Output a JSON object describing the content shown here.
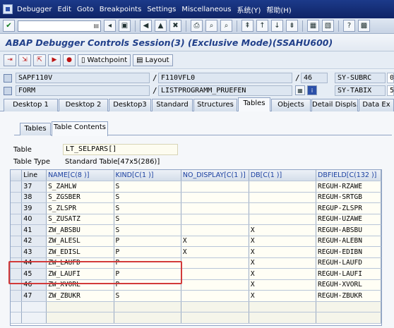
{
  "menu": [
    "Debugger",
    "Edit",
    "Goto",
    "Breakpoints",
    "Settings",
    "Miscellaneous",
    "系统(Y)",
    "帮助(H)"
  ],
  "title": "ABAP Debugger Controls Session(3)  (Exclusive Mode)(SSAHU600)",
  "toolbar": {
    "watchpoint": "Watchpoint",
    "layout": "Layout"
  },
  "info": {
    "program": "SAPF110V",
    "include": "F110VFL0",
    "line": "46",
    "subrc_label": "SY-SUBRC",
    "subrc_value": "0",
    "event_type": "FORM",
    "event_name": "LISTPROGRAMM_PRUEFEN",
    "tabix_label": "SY-TABIX",
    "tabix_value": "5"
  },
  "tabs": [
    "Desktop 1",
    "Desktop 2",
    "Desktop3",
    "Standard",
    "Structures",
    "Tables",
    "Objects",
    "Detail Displs.",
    "Data Ex"
  ],
  "subtabs": [
    "Tables",
    "Table Contents"
  ],
  "table": {
    "name_label": "Table",
    "name_value": "LT_SELPARS[]",
    "type_label": "Table Type",
    "type_value": "Standard Table[47x5(286)]"
  },
  "grid": {
    "headers": [
      "Line",
      "NAME[C(8 )]",
      "KIND[C(1 )]",
      "NO_DISPLAY[C(1 )]",
      "DB[C(1 )]",
      "DBFIELD[C(132 )]"
    ],
    "rows": [
      [
        "37",
        "S_ZAHLW",
        "S",
        "",
        "",
        "REGUH-RZAWE"
      ],
      [
        "38",
        "S_ZGSBER",
        "S",
        "",
        "",
        "REGUH-SRTGB"
      ],
      [
        "39",
        "S_ZLSPR",
        "S",
        "",
        "",
        "REGUP-ZLSPR"
      ],
      [
        "40",
        "S_ZUSATZ",
        "S",
        "",
        "",
        "REGUH-UZAWE"
      ],
      [
        "41",
        "ZW_ABSBU",
        "S",
        "",
        "X",
        "REGUH-ABSBU"
      ],
      [
        "42",
        "ZW_ALESL",
        "P",
        "X",
        "X",
        "REGUH-ALEBN"
      ],
      [
        "43",
        "ZW_EDISL",
        "P",
        "X",
        "X",
        "REGUH-EDIBN"
      ],
      [
        "44",
        "ZW_LAUFD",
        "P",
        "",
        "X",
        "REGUH-LAUFD"
      ],
      [
        "45",
        "ZW_LAUFI",
        "P",
        "",
        "X",
        "REGUH-LAUFI"
      ],
      [
        "46",
        "ZW_XVORL",
        "P",
        "",
        "X",
        "REGUH-XVORL"
      ],
      [
        "47",
        "ZW_ZBUKR",
        "S",
        "",
        "X",
        "REGUH-ZBUKR"
      ]
    ]
  }
}
